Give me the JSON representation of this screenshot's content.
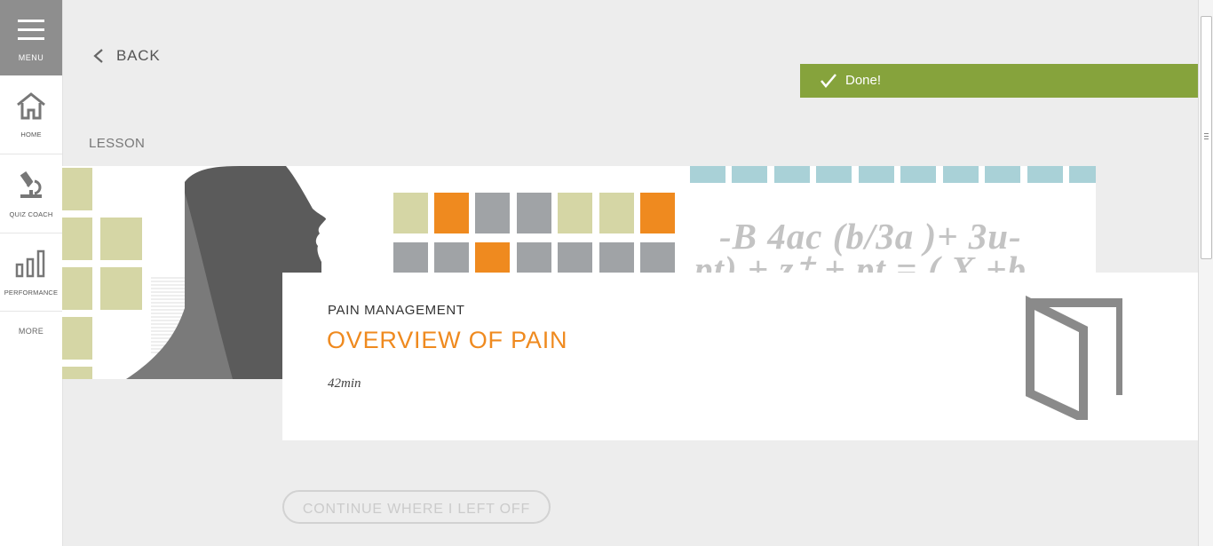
{
  "sidebar": {
    "menu_label": "MENU",
    "items": [
      {
        "label": "HOME",
        "icon": "home-icon"
      },
      {
        "label": "QUIZ COACH",
        "icon": "microscope-icon"
      },
      {
        "label": "PERFORMANCE",
        "icon": "bar-chart-icon"
      }
    ],
    "more_label": "MORE"
  },
  "header": {
    "back_label": "BACK"
  },
  "status": {
    "done_label": "Done!",
    "color": "#86a33c"
  },
  "lesson": {
    "section_label": "LESSON",
    "course": "PAIN MANAGEMENT",
    "title": "OVERVIEW OF PAIN",
    "duration": "42min",
    "banner_math_line1": "-B 4ac (b/3a )+ 3u-",
    "banner_math_line2": "pt) + z⁺ + pt = ( X +b",
    "title_color": "#ef8a1f"
  },
  "actions": {
    "continue_label": "CONTINUE WHERE I LEFT OFF"
  }
}
